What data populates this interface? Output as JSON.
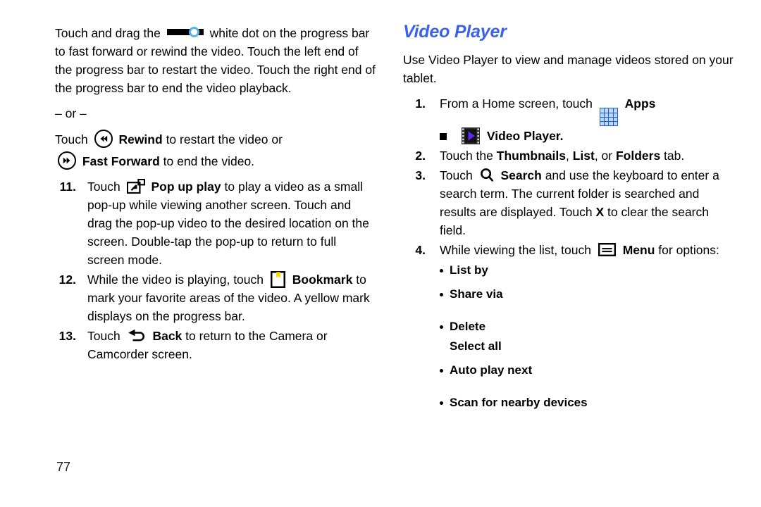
{
  "page": {
    "number": "77"
  },
  "left_column": {
    "intro_paragraph": {
      "before_icon": "Touch and drag the",
      "icon": "progress-bar-slider-icon",
      "after_icon": "white dot on the progress bar to fast forward or rewind the video. Touch the left end of the progress bar to restart the video. Touch the right end of the progress bar to end the video playback."
    },
    "or_separator": "– or –",
    "rewind_line": {
      "touch": "Touch",
      "icon": "rewind-icon",
      "label": "Rewind",
      "rest": "to restart the video or"
    },
    "fast_forward_line": {
      "icon": "fast-forward-icon",
      "label": "Fast Forward",
      "rest": "to end the video."
    },
    "steps": [
      {
        "number": "11.",
        "touch": "Touch",
        "icon": "pop-up-play-icon",
        "label": "Pop up play",
        "rest": "to play a video as a small pop-up while viewing another screen. Touch and drag the pop-up video to the desired location on the screen. Double-tap the pop-up to return to full screen mode."
      },
      {
        "number": "12.",
        "touch": "While the video is playing, touch",
        "icon": "bookmark-icon",
        "label": "Bookmark",
        "rest": "to mark your favorite areas of the video. A yellow mark displays on the progress bar."
      },
      {
        "number": "13.",
        "touch": "Touch",
        "icon": "back-icon",
        "label": "Back",
        "rest": "to return to the Camera or Camcorder screen."
      }
    ]
  },
  "right_column": {
    "heading": "Video Player",
    "intro": "Use Video Player to view and manage videos stored on your tablet.",
    "steps": [
      {
        "number": "1.",
        "text_before": "From a Home screen, touch",
        "icon": "apps-grid-icon",
        "label": "Apps",
        "text_after": "",
        "sub_item": {
          "bullet": "square",
          "icon": "video-player-icon",
          "label": "Video Player",
          "suffix": "."
        }
      },
      {
        "number": "2.",
        "segments": [
          {
            "t": "Touch the ",
            "b": false
          },
          {
            "t": "Thumbnails",
            "b": true
          },
          {
            "t": ", ",
            "b": false
          },
          {
            "t": "List",
            "b": true
          },
          {
            "t": ", or ",
            "b": false
          },
          {
            "t": "Folders",
            "b": true
          },
          {
            "t": " tab.",
            "b": false
          }
        ]
      },
      {
        "number": "3.",
        "text_before": "Touch",
        "icon": "search-icon",
        "label": "Search",
        "text_after_segments": [
          {
            "t": " and use the keyboard to enter a search term. The current folder is searched and results are displayed. Touch ",
            "b": false
          },
          {
            "t": "X",
            "b": true
          },
          {
            "t": " to clear the search field.",
            "b": false
          }
        ]
      },
      {
        "number": "4.",
        "text_before": "While viewing the list, touch",
        "icon": "menu-icon",
        "label": "Menu",
        "text_after": "for options:"
      }
    ],
    "menu_options": [
      {
        "label": "List by",
        "bullet": true,
        "gap_before": false
      },
      {
        "label": "Share via",
        "bullet": true,
        "gap_before": false
      },
      {
        "label": "Delete",
        "bullet": true,
        "gap_before": true
      },
      {
        "label": "Select all",
        "bullet": false,
        "gap_before": false
      },
      {
        "label": "Auto play next",
        "bullet": true,
        "gap_before": false
      },
      {
        "label": "Scan for nearby devices",
        "bullet": true,
        "gap_before": true
      }
    ]
  },
  "colors": {
    "heading_blue": "#3b62e8",
    "apps_icon_blue": "#1c5fd0",
    "apps_icon_cell": "#bcd7f5",
    "play_triangle_purple": "#5a2ee8",
    "bookmark_yellow": "#ffd700",
    "slider_ring_blue": "#5ab4e5"
  }
}
